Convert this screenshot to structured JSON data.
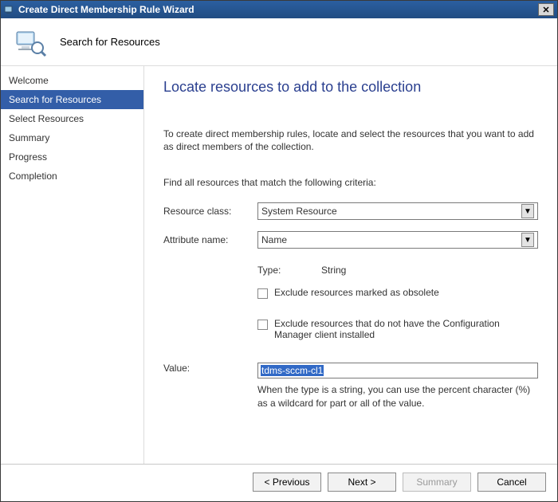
{
  "titlebar": {
    "title": "Create Direct Membership Rule Wizard"
  },
  "header": {
    "subtitle": "Search for Resources"
  },
  "sidebar": {
    "items": [
      {
        "label": "Welcome",
        "active": false
      },
      {
        "label": "Search for Resources",
        "active": true
      },
      {
        "label": "Select Resources",
        "active": false
      },
      {
        "label": "Summary",
        "active": false
      },
      {
        "label": "Progress",
        "active": false
      },
      {
        "label": "Completion",
        "active": false
      }
    ]
  },
  "page": {
    "title": "Locate resources to add to the collection",
    "intro": "To create direct membership rules, locate and select the resources that you want to add as direct members of the collection.",
    "criteria_label": "Find all resources that match the following criteria:",
    "resource_class_label": "Resource class:",
    "resource_class_value": "System Resource",
    "attribute_name_label": "Attribute name:",
    "attribute_name_value": "Name",
    "type_label": "Type:",
    "type_value": "String",
    "exclude_obsolete_label": "Exclude resources marked as obsolete",
    "exclude_noclient_label": "Exclude resources that do not have the Configuration Manager client installed",
    "value_label": "Value:",
    "value_input": "tdms-sccm-cl1",
    "value_note": "When the type is a string, you can use the percent character (%) as a wildcard for part or all of the value."
  },
  "buttons": {
    "previous": "< Previous",
    "next": "Next >",
    "summary": "Summary",
    "cancel": "Cancel"
  }
}
